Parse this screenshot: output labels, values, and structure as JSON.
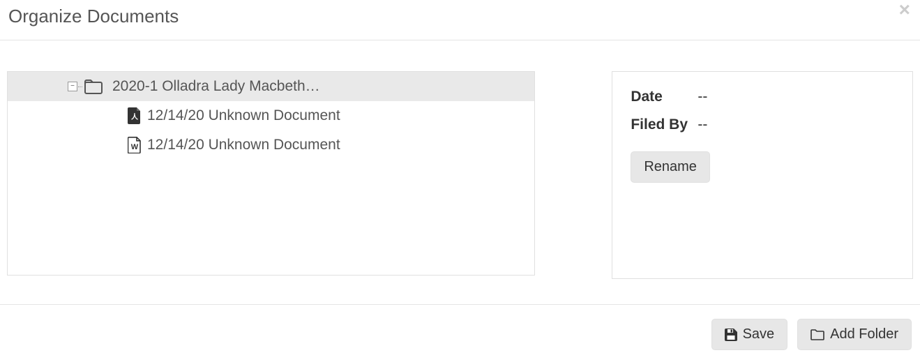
{
  "modal": {
    "title": "Organize Documents"
  },
  "tree": {
    "root": {
      "label": "2020-1 Olladra Lady Macbeth…",
      "toggle_glyph": "−"
    },
    "items": [
      {
        "type": "pdf",
        "label": "12/14/20 Unknown Document"
      },
      {
        "type": "word",
        "label": "12/14/20 Unknown Document"
      }
    ]
  },
  "info": {
    "date_label": "Date",
    "date_value": "--",
    "filed_by_label": "Filed By",
    "filed_by_value": "--",
    "rename_label": "Rename"
  },
  "footer": {
    "save_label": "Save",
    "add_folder_label": "Add Folder"
  }
}
